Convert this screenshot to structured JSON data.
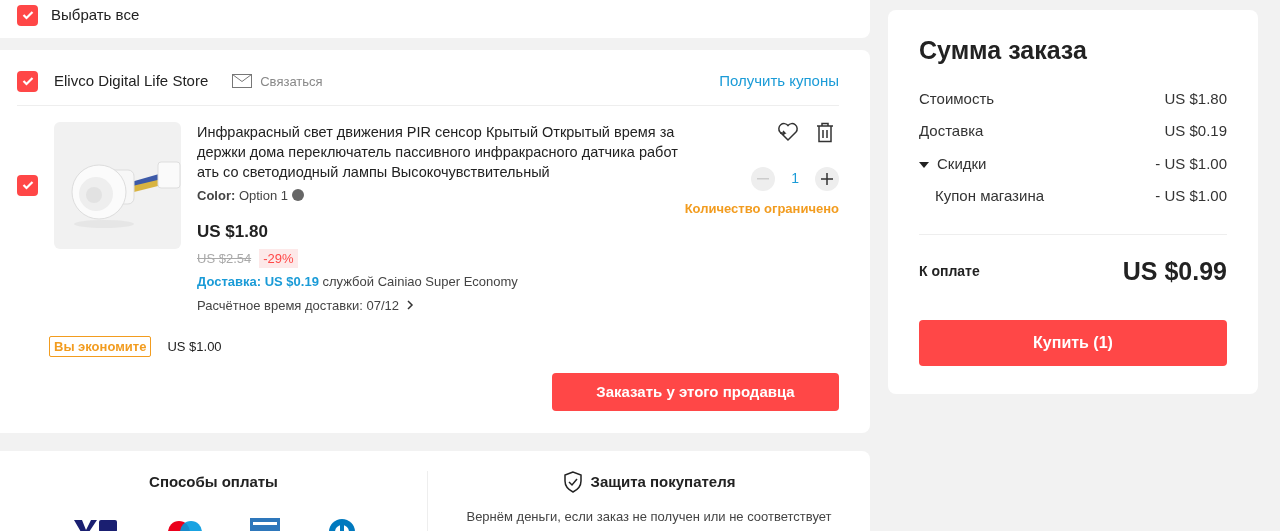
{
  "select_all": {
    "label": "Выбрать все",
    "checked": true
  },
  "store": {
    "checked": true,
    "name": "Elivco Digital Life Store",
    "contact": "Связаться",
    "coupons_link": "Получить купоны"
  },
  "item": {
    "checked": true,
    "title": "Инфракрасный свет движения PIR сенсор Крытый Открытый время задержки дома переключатель пассивного инфракрасного датчика работать со светодиодный лампы Высокочувствительный",
    "color_label": "Color:",
    "color_value": "Option 1",
    "price": "US $1.80",
    "old_price": "US $2.54",
    "discount": "-29%",
    "shipping": "Доставка: US $0.19",
    "shipping_service": "службой Cainiao Super Economy",
    "delivery_estimate": "Расчётное время доставки: 07/12",
    "minus_disabled": true,
    "quantity": "1",
    "quantity_note": "Количество ограничено",
    "savings_label": "Вы экономите",
    "savings_value": "US $1.00"
  },
  "order_button": "Заказать у этого продавца",
  "summary": {
    "title": "Сумма заказа",
    "lines": [
      {
        "label": "Стоимость",
        "value": "US $1.80"
      },
      {
        "label": "Доставка",
        "value": "US $0.19"
      },
      {
        "label": "Скидки",
        "value": "- US $1.00",
        "expanded": true,
        "children": [
          {
            "label": "Купон магазина",
            "value": "- US $1.00"
          }
        ]
      }
    ],
    "total_label": "К оплате",
    "total": "US $0.99",
    "buy_button": "Купить (1)"
  },
  "payment": {
    "title": "Способы оплаты"
  },
  "protection": {
    "title": "Защита покупателя",
    "text": "Вернём деньги, если заказ не получен или не соответствует"
  }
}
